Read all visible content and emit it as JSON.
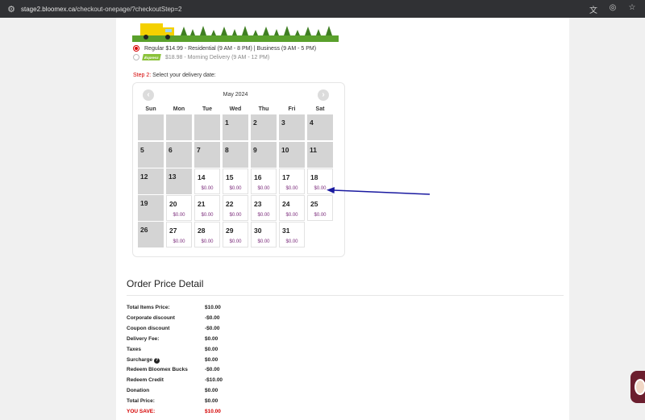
{
  "browser": {
    "url_host": "stage2.bloomex.ca",
    "url_path": "/checkout-onepage/?checkoutStep=2"
  },
  "delivery_options": [
    {
      "label": "Regular $14.99 - Residential (9 AM - 8 PM) | Business (9 AM - 5 PM)",
      "selected": true
    },
    {
      "badge": "Express",
      "label": "$18.98 - Morning Delivery (9 AM - 12 PM)",
      "selected": false
    }
  ],
  "step": {
    "prefix": "Step 2:",
    "text": " Select your delivery date:"
  },
  "calendar": {
    "month": "May 2024",
    "weekdays": [
      "Sun",
      "Mon",
      "Tue",
      "Wed",
      "Thu",
      "Fri",
      "Sat"
    ],
    "weeks": [
      [
        {
          "day": "",
          "enabled": false
        },
        {
          "day": "",
          "enabled": false
        },
        {
          "day": "",
          "enabled": false
        },
        {
          "day": "1",
          "enabled": false
        },
        {
          "day": "2",
          "enabled": false
        },
        {
          "day": "3",
          "enabled": false
        },
        {
          "day": "4",
          "enabled": false
        }
      ],
      [
        {
          "day": "5",
          "enabled": false
        },
        {
          "day": "6",
          "enabled": false
        },
        {
          "day": "7",
          "enabled": false
        },
        {
          "day": "8",
          "enabled": false
        },
        {
          "day": "9",
          "enabled": false
        },
        {
          "day": "10",
          "enabled": false
        },
        {
          "day": "11",
          "enabled": false
        }
      ],
      [
        {
          "day": "12",
          "enabled": false
        },
        {
          "day": "13",
          "enabled": false
        },
        {
          "day": "14",
          "enabled": true,
          "price": "$0.00"
        },
        {
          "day": "15",
          "enabled": true,
          "price": "$0.00"
        },
        {
          "day": "16",
          "enabled": true,
          "price": "$0.00"
        },
        {
          "day": "17",
          "enabled": true,
          "price": "$0.00"
        },
        {
          "day": "18",
          "enabled": true,
          "price": "$0.00"
        }
      ],
      [
        {
          "day": "19",
          "enabled": false
        },
        {
          "day": "20",
          "enabled": true,
          "price": "$0.00"
        },
        {
          "day": "21",
          "enabled": true,
          "price": "$0.00"
        },
        {
          "day": "22",
          "enabled": true,
          "price": "$0.00"
        },
        {
          "day": "23",
          "enabled": true,
          "price": "$0.00"
        },
        {
          "day": "24",
          "enabled": true,
          "price": "$0.00"
        },
        {
          "day": "25",
          "enabled": true,
          "price": "$0.00"
        }
      ],
      [
        {
          "day": "26",
          "enabled": false
        },
        {
          "day": "27",
          "enabled": true,
          "price": "$0.00"
        },
        {
          "day": "28",
          "enabled": true,
          "price": "$0.00"
        },
        {
          "day": "29",
          "enabled": true,
          "price": "$0.00"
        },
        {
          "day": "30",
          "enabled": true,
          "price": "$0.00"
        },
        {
          "day": "31",
          "enabled": true,
          "price": "$0.00"
        }
      ]
    ]
  },
  "order_detail": {
    "title": "Order Price Detail",
    "rows": [
      {
        "label": "Total Items Price:",
        "value": "$10.00"
      },
      {
        "label": "Corporate discount",
        "value": "-$0.00"
      },
      {
        "label": "Coupon discount",
        "value": "-$0.00"
      },
      {
        "label": "Delivery Fee:",
        "value": "$0.00"
      },
      {
        "label": "Taxes",
        "value": "$0.00"
      },
      {
        "label": "Surcharge",
        "value": "$0.00",
        "help": true
      },
      {
        "label": "Redeem Bloomex Bucks",
        "value": "-$0.00"
      },
      {
        "label": "Redeem Credit",
        "value": "-$10.00"
      },
      {
        "label": "Donation",
        "value": "$0.00"
      },
      {
        "label": "Total Price:",
        "value": "$0.00"
      },
      {
        "label": "YOU SAVE:",
        "value": "$10.00",
        "highlight": true
      }
    ]
  },
  "colors": {
    "accent_red": "#d40000",
    "price_purple": "#7a2a7a",
    "disabled_cell": "#d4d4d4",
    "annotation_arrow": "#1a1aa0"
  }
}
